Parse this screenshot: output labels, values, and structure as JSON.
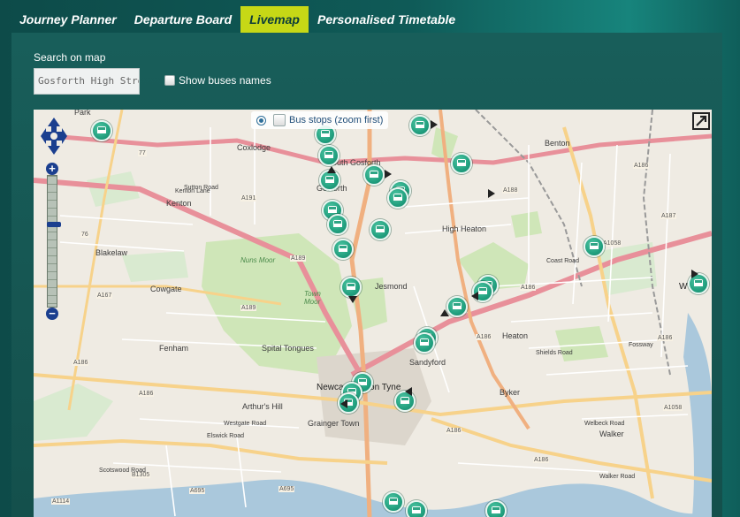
{
  "nav": {
    "tabs": [
      {
        "label": "Journey Planner"
      },
      {
        "label": "Departure Board"
      },
      {
        "label": "Livemap",
        "active": true
      },
      {
        "label": "Personalised Timetable"
      }
    ]
  },
  "search": {
    "label": "Search on map",
    "value": "Gosforth High Street-T",
    "show_buses_label": "Show buses names",
    "show_buses_checked": false
  },
  "map": {
    "layer_switcher": {
      "label": "Bus stops (zoom first)",
      "checked": false
    },
    "places": [
      {
        "name": "Park"
      },
      {
        "name": "Coxlodge"
      },
      {
        "name": "South Gosforth"
      },
      {
        "name": "Benton"
      },
      {
        "name": "Gosforth"
      },
      {
        "name": "Kenton"
      },
      {
        "name": "Kenton Lane"
      },
      {
        "name": "High Heaton"
      },
      {
        "name": "Blakelaw"
      },
      {
        "name": "Nuns Moor"
      },
      {
        "name": "Jesmond"
      },
      {
        "name": "Cowgate"
      },
      {
        "name": "Town Moor"
      },
      {
        "name": "Heaton"
      },
      {
        "name": "Fenham"
      },
      {
        "name": "Spital Tongues"
      },
      {
        "name": "Sandyford"
      },
      {
        "name": "Newcastle upon Tyne"
      },
      {
        "name": "Byker"
      },
      {
        "name": "Arthur's Hill"
      },
      {
        "name": "Grainger Town"
      },
      {
        "name": "Walker"
      },
      {
        "name": "Coast Road"
      },
      {
        "name": "Fossway"
      },
      {
        "name": "Shields Road"
      },
      {
        "name": "Westgate Road"
      },
      {
        "name": "Elswick Road"
      },
      {
        "name": "Scotswood Road"
      },
      {
        "name": "Walker Road"
      },
      {
        "name": "Welbeck Road"
      },
      {
        "name": "Sutton Road"
      },
      {
        "name": "W"
      }
    ],
    "road_refs": [
      "77",
      "76",
      "A191",
      "A189",
      "A189",
      "A167",
      "A188",
      "A186",
      "A186",
      "A186",
      "A186",
      "A1058",
      "A187",
      "A186",
      "A186",
      "A1058",
      "B1305",
      "A695",
      "A695",
      "A1114",
      "A186",
      "A186"
    ],
    "bus_count": 32
  },
  "colors": {
    "nav_active": "#c6d816",
    "panel": "#185e5a",
    "bus_marker": "#22a07f",
    "zoom_control": "#1b3f8f"
  },
  "icons": [
    "pan-control-icon",
    "zoom-in-icon",
    "zoom-out-icon",
    "fullscreen-icon",
    "bus-icon"
  ]
}
